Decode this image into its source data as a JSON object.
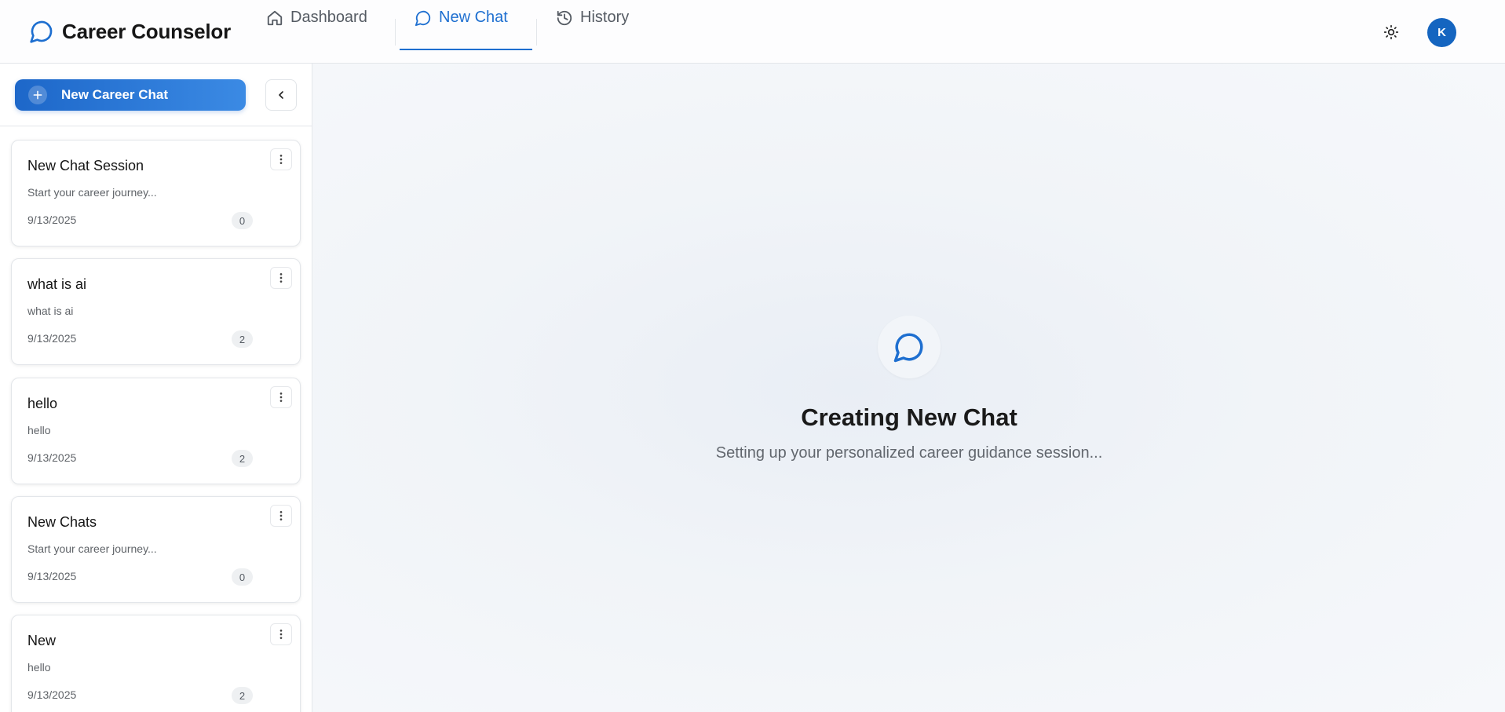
{
  "app": {
    "title": "Career Counselor",
    "accent_color": "#1e6fd0"
  },
  "nav": {
    "items": [
      {
        "label": "Dashboard",
        "icon": "home-icon",
        "active": false
      },
      {
        "label": "New Chat",
        "icon": "chat-bubble-icon",
        "active": true
      },
      {
        "label": "History",
        "icon": "history-icon",
        "active": false
      }
    ]
  },
  "header": {
    "theme_toggle_icon": "sun-icon",
    "avatar_initial": "K"
  },
  "sidebar": {
    "new_chat_label": "New Career Chat",
    "collapse_icon": "chevron-left-icon",
    "sessions": [
      {
        "title": "New Chat Session",
        "preview": "Start your career journey...",
        "date": "9/13/2025",
        "count": "0"
      },
      {
        "title": "what is ai",
        "preview": "what is ai",
        "date": "9/13/2025",
        "count": "2"
      },
      {
        "title": "hello",
        "preview": "hello",
        "date": "9/13/2025",
        "count": "2"
      },
      {
        "title": "New Chats",
        "preview": "Start your career journey...",
        "date": "9/13/2025",
        "count": "0"
      },
      {
        "title": "New",
        "preview": "hello",
        "date": "9/13/2025",
        "count": "2"
      }
    ]
  },
  "main": {
    "icon": "chat-bubble-icon",
    "title": "Creating New Chat",
    "subtitle": "Setting up your personalized career guidance session..."
  }
}
